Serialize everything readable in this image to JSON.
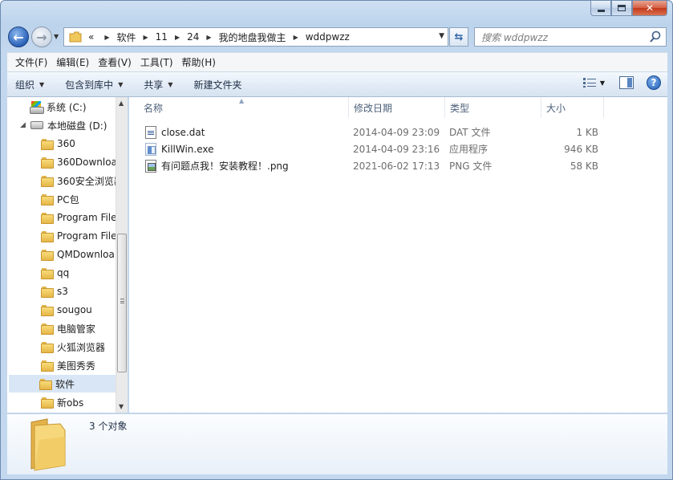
{
  "window": {
    "caption": {
      "min": "",
      "max": "",
      "close": "✕"
    }
  },
  "address_bar": {
    "overflow": "«",
    "crumbs": [
      "软件",
      "11",
      "24",
      "我的地盘我做主",
      "wddpwzz"
    ]
  },
  "search": {
    "placeholder": "搜索 wddpwzz"
  },
  "menu": [
    "文件(F)",
    "编辑(E)",
    "查看(V)",
    "工具(T)",
    "帮助(H)"
  ],
  "commands": [
    "组织",
    "包含到库中",
    "共享",
    "新建文件夹"
  ],
  "help_label": "?",
  "nav": {
    "items": [
      {
        "label": "系统 (C:)",
        "icon": "system-drive-icon"
      },
      {
        "label": "本地磁盘 (D:)",
        "icon": "drive-icon"
      },
      {
        "label": "360",
        "icon": "folder-icon"
      },
      {
        "label": "360Downloa",
        "icon": "folder-icon"
      },
      {
        "label": "360安全浏览器",
        "icon": "folder-icon"
      },
      {
        "label": "PC包",
        "icon": "folder-icon"
      },
      {
        "label": "Program File",
        "icon": "folder-icon"
      },
      {
        "label": "Program File",
        "icon": "folder-icon"
      },
      {
        "label": "QMDownloa",
        "icon": "folder-icon"
      },
      {
        "label": "qq",
        "icon": "folder-icon"
      },
      {
        "label": "s3",
        "icon": "folder-icon"
      },
      {
        "label": "sougou",
        "icon": "folder-icon"
      },
      {
        "label": "电脑管家",
        "icon": "folder-icon"
      },
      {
        "label": "火狐浏览器",
        "icon": "folder-icon"
      },
      {
        "label": "美图秀秀",
        "icon": "folder-icon"
      },
      {
        "label": "软件",
        "icon": "folder-icon",
        "selected": true
      },
      {
        "label": "新obs",
        "icon": "folder-icon"
      }
    ]
  },
  "columns": {
    "name": "名称",
    "modified": "修改日期",
    "type": "类型",
    "size": "大小"
  },
  "files": [
    {
      "name": "close.dat",
      "modified": "2014-04-09 23:09",
      "type": "DAT 文件",
      "size": "1 KB",
      "icon": "dat-file-icon"
    },
    {
      "name": "KillWin.exe",
      "modified": "2014-04-09 23:16",
      "type": "应用程序",
      "size": "946 KB",
      "icon": "exe-file-icon"
    },
    {
      "name": "有问题点我！安装教程！.png",
      "modified": "2021-06-02 17:13",
      "type": "PNG 文件",
      "size": "58 KB",
      "icon": "png-file-icon"
    }
  ],
  "details": {
    "count": "3 个对象"
  },
  "colors": {
    "selection": "#d9e6f5",
    "accent": "#2b62b8"
  }
}
